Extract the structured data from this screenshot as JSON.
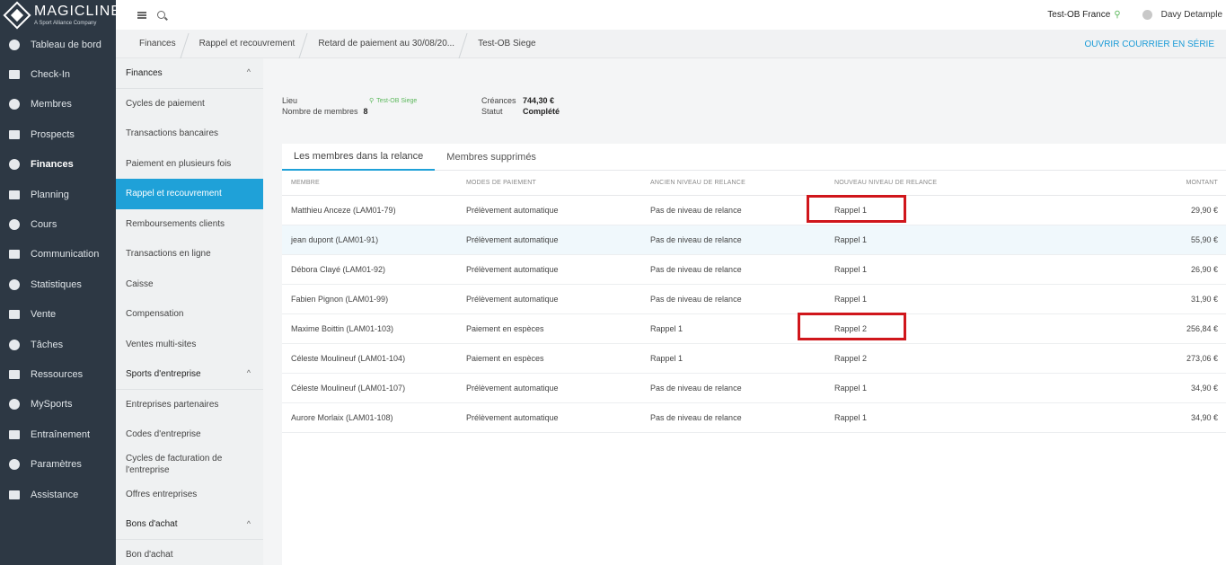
{
  "brand": {
    "name": "MAGICLINE",
    "sub": "A Sport Alliance Company"
  },
  "nav": [
    {
      "label": "Tableau de bord",
      "icon": "dashboard-icon"
    },
    {
      "label": "Check-In",
      "icon": "check-in-icon"
    },
    {
      "label": "Membres",
      "icon": "members-icon"
    },
    {
      "label": "Prospects",
      "icon": "prospects-icon"
    },
    {
      "label": "Finances",
      "icon": "finances-icon",
      "active": true
    },
    {
      "label": "Planning",
      "icon": "calendar-icon"
    },
    {
      "label": "Cours",
      "icon": "courses-icon"
    },
    {
      "label": "Communication",
      "icon": "chat-icon"
    },
    {
      "label": "Statistiques",
      "icon": "chart-icon"
    },
    {
      "label": "Vente",
      "icon": "cart-icon"
    },
    {
      "label": "Tâches",
      "icon": "tasks-icon"
    },
    {
      "label": "Ressources",
      "icon": "resources-icon"
    },
    {
      "label": "MySports",
      "icon": "mysports-icon"
    },
    {
      "label": "Entraînement",
      "icon": "training-icon"
    },
    {
      "label": "Paramètres",
      "icon": "settings-icon"
    },
    {
      "label": "Assistance",
      "icon": "assistance-icon"
    }
  ],
  "topbar": {
    "org": "Test-OB France",
    "user": "Davy Detample"
  },
  "breadcrumb": [
    "Finances",
    "Rappel et recouvrement",
    "Retard de paiement au 30/08/20...",
    "Test-OB Siege"
  ],
  "cta": "OUVRIR COURRIER EN SÉRIE",
  "submenu": [
    {
      "label": "Finances",
      "type": "head"
    },
    {
      "label": "Cycles de paiement"
    },
    {
      "label": "Transactions bancaires"
    },
    {
      "label": "Paiement en plusieurs fois"
    },
    {
      "label": "Rappel et recouvrement",
      "active": true
    },
    {
      "label": "Remboursements clients"
    },
    {
      "label": "Transactions en ligne"
    },
    {
      "label": "Caisse"
    },
    {
      "label": "Compensation"
    },
    {
      "label": "Ventes multi-sites"
    },
    {
      "label": "Sports d'entreprise",
      "type": "head"
    },
    {
      "label": "Entreprises partenaires"
    },
    {
      "label": "Codes d'entreprise"
    },
    {
      "label": "Cycles de facturation de l'entreprise"
    },
    {
      "label": "Offres entreprises"
    },
    {
      "label": "Bons d'achat",
      "type": "head"
    },
    {
      "label": "Bon d'achat"
    }
  ],
  "summary": {
    "lieu_label": "Lieu",
    "lieu_value": "Test-OB Siege",
    "members_label": "Nombre de membres",
    "members_value": "8",
    "creances_label": "Créances",
    "creances_value": "744,30 €",
    "statut_label": "Statut",
    "statut_value": "Complété"
  },
  "tabs": [
    "Les membres dans la relance",
    "Membres supprimés"
  ],
  "columns": [
    "Membre",
    "Modes de paiement",
    "Ancien niveau de relance",
    "Nouveau niveau de relance",
    "Montant"
  ],
  "rows": [
    {
      "member": "Matthieu Anceze (LAM01-79)",
      "mode": "Prélèvement automatique",
      "old": "Pas de niveau de relance",
      "new": "Rappel 1",
      "amount": "29,90 €"
    },
    {
      "member": "jean dupont (LAM01-91)",
      "mode": "Prélèvement automatique",
      "old": "Pas de niveau de relance",
      "new": "Rappel 1",
      "amount": "55,90 €"
    },
    {
      "member": "Débora Clayé (LAM01-92)",
      "mode": "Prélèvement automatique",
      "old": "Pas de niveau de relance",
      "new": "Rappel 1",
      "amount": "26,90 €"
    },
    {
      "member": "Fabien Pignon (LAM01-99)",
      "mode": "Prélèvement automatique",
      "old": "Pas de niveau de relance",
      "new": "Rappel 1",
      "amount": "31,90 €"
    },
    {
      "member": "Maxime Boittin (LAM01-103)",
      "mode": "Paiement en espèces",
      "old": "Rappel 1",
      "new": "Rappel 2",
      "amount": "256,84 €"
    },
    {
      "member": "Céleste Moulineuf (LAM01-104)",
      "mode": "Paiement en espèces",
      "old": "Rappel 1",
      "new": "Rappel 2",
      "amount": "273,06 €"
    },
    {
      "member": "Céleste Moulineuf (LAM01-107)",
      "mode": "Prélèvement automatique",
      "old": "Pas de niveau de relance",
      "new": "Rappel 1",
      "amount": "34,90 €"
    },
    {
      "member": "Aurore Morlaix (LAM01-108)",
      "mode": "Prélèvement automatique",
      "old": "Pas de niveau de relance",
      "new": "Rappel 1",
      "amount": "34,90 €"
    }
  ],
  "colors": {
    "nav_bg": "#2d3844",
    "accent": "#1fa1d8",
    "highlight": "#d0161b",
    "location": "#5cb85c"
  }
}
